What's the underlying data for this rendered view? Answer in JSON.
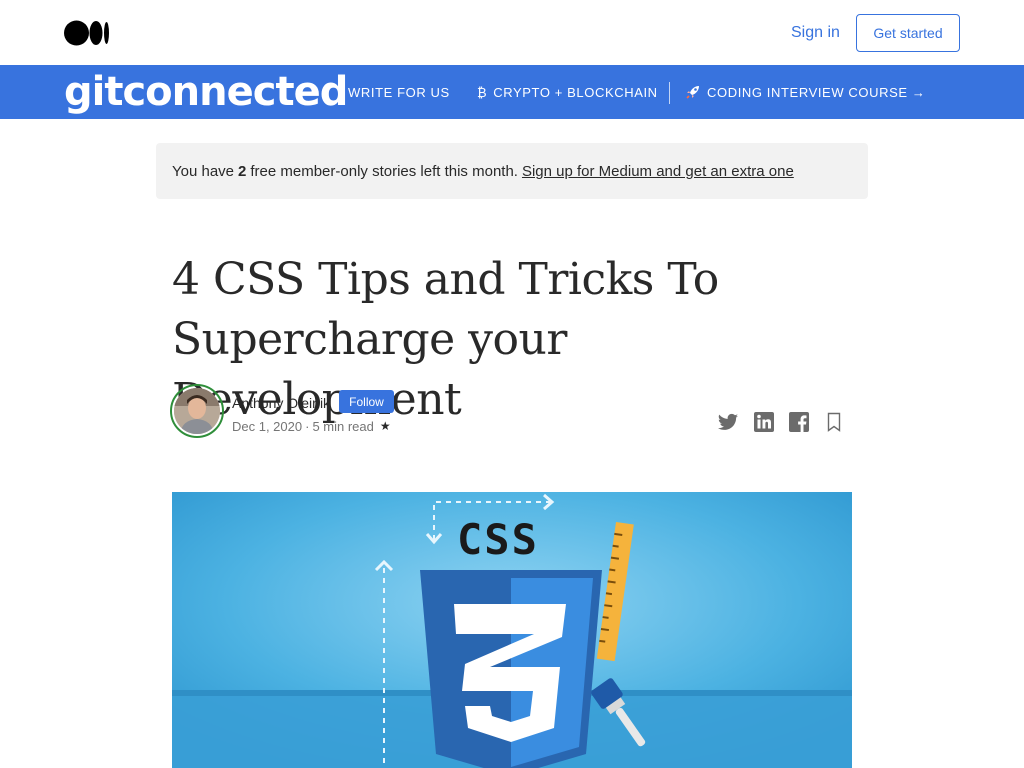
{
  "topbar": {
    "signin_label": "Sign in",
    "getstarted_label": "Get started"
  },
  "publication": {
    "logo_text": "gitconnected",
    "nav": {
      "write": "WRITE FOR US",
      "crypto": "CRYPTO + BLOCKCHAIN",
      "crypto_icon": "bitcoin-icon",
      "coding": "CODING INTERVIEW COURSE →",
      "coding_icon": "rocket-icon"
    },
    "color": "#3873de"
  },
  "notice": {
    "prefix": "You have",
    "count": "2",
    "suffix": "free member-only stories left this month.",
    "link": "Sign up for Medium and get an extra one"
  },
  "article": {
    "title": "4 CSS Tips and Tricks To Supercharge your Development",
    "author": "Anthony Oleinik",
    "follow_label": "Follow",
    "date": "Dec 1, 2020",
    "dot": "·",
    "read_time": "5 min read",
    "star": "★"
  },
  "hero": {
    "logo_text": "CSS",
    "number": "3"
  },
  "colors": {
    "accent": "#3873de",
    "hero_bg": "#3fa6dc",
    "css_shield": "#2966b0",
    "css_shield_light": "#3a8de0",
    "ruler": "#f5b33c"
  }
}
